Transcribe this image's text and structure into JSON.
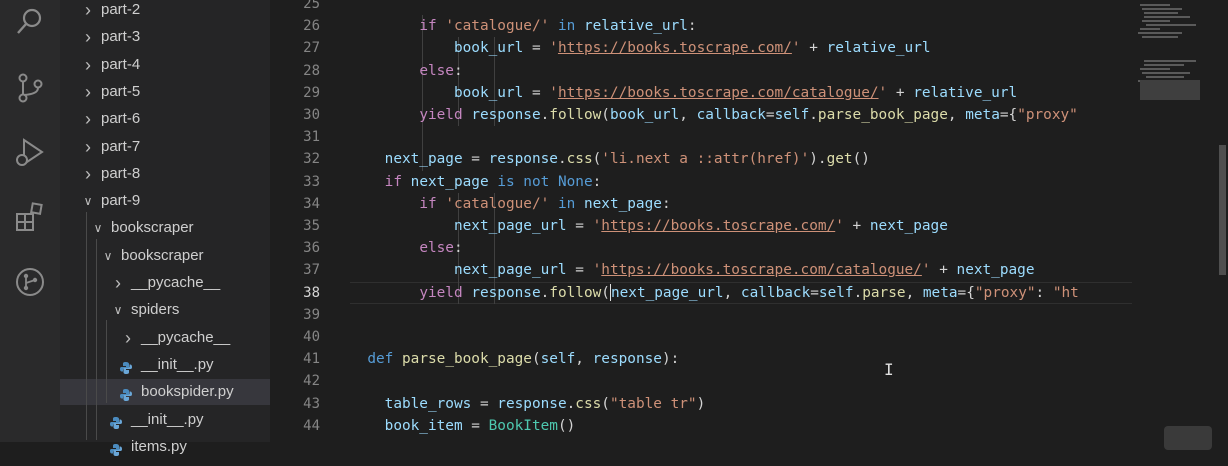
{
  "activity_bar": {
    "icons": [
      "search-icon",
      "source-control-icon",
      "run-debug-icon",
      "extensions-icon",
      "remote-explorer-icon"
    ]
  },
  "explorer": {
    "items": [
      {
        "label": "part-2",
        "kind": "folder",
        "expanded": false
      },
      {
        "label": "part-3",
        "kind": "folder",
        "expanded": false
      },
      {
        "label": "part-4",
        "kind": "folder",
        "expanded": false
      },
      {
        "label": "part-5",
        "kind": "folder",
        "expanded": false
      },
      {
        "label": "part-6",
        "kind": "folder",
        "expanded": false
      },
      {
        "label": "part-7",
        "kind": "folder",
        "expanded": false
      },
      {
        "label": "part-8",
        "kind": "folder",
        "expanded": false
      },
      {
        "label": "part-9",
        "kind": "folder",
        "expanded": true
      },
      {
        "label": "bookscraper",
        "kind": "folder",
        "expanded": true
      },
      {
        "label": "bookscraper",
        "kind": "folder",
        "expanded": true
      },
      {
        "label": "__pycache__",
        "kind": "folder",
        "expanded": false
      },
      {
        "label": "spiders",
        "kind": "folder",
        "expanded": true
      },
      {
        "label": "__pycache__",
        "kind": "folder",
        "expanded": false
      },
      {
        "label": "__init__.py",
        "kind": "python-file"
      },
      {
        "label": "bookspider.py",
        "kind": "python-file",
        "selected": true
      },
      {
        "label": "__init__.py",
        "kind": "python-file"
      },
      {
        "label": "items.py",
        "kind": "python-file"
      }
    ]
  },
  "editor": {
    "active_line": "38",
    "line_numbers": [
      "25",
      "26",
      "27",
      "28",
      "29",
      "30",
      "31",
      "32",
      "33",
      "34",
      "35",
      "36",
      "37",
      "38",
      "39",
      "40",
      "41",
      "42",
      "43",
      "44"
    ],
    "lines": [
      [],
      [
        [
          "p",
          "        "
        ],
        [
          "ctl",
          "if "
        ],
        [
          "str",
          "'catalogue/'"
        ],
        [
          "p",
          " "
        ],
        [
          "kw",
          "in"
        ],
        [
          "p",
          " "
        ],
        [
          "var",
          "relative_url"
        ],
        [
          "p",
          ":"
        ]
      ],
      [
        [
          "p",
          "            "
        ],
        [
          "var",
          "book_url"
        ],
        [
          "p",
          " = "
        ],
        [
          "str",
          "'"
        ],
        [
          "url",
          "https://books.toscrape.com/"
        ],
        [
          "str",
          "'"
        ],
        [
          "p",
          " + "
        ],
        [
          "var",
          "relative_url"
        ]
      ],
      [
        [
          "p",
          "        "
        ],
        [
          "ctl",
          "else"
        ],
        [
          "p",
          ":"
        ]
      ],
      [
        [
          "p",
          "            "
        ],
        [
          "var",
          "book_url"
        ],
        [
          "p",
          " = "
        ],
        [
          "str",
          "'"
        ],
        [
          "url",
          "https://books.toscrape.com/catalogue/"
        ],
        [
          "str",
          "'"
        ],
        [
          "p",
          " + "
        ],
        [
          "var",
          "relative_url"
        ]
      ],
      [
        [
          "p",
          "        "
        ],
        [
          "ctl",
          "yield"
        ],
        [
          "p",
          " "
        ],
        [
          "var",
          "response"
        ],
        [
          "p",
          "."
        ],
        [
          "fn",
          "follow"
        ],
        [
          "p",
          "("
        ],
        [
          "var",
          "book_url"
        ],
        [
          "p",
          ", "
        ],
        [
          "var",
          "callback"
        ],
        [
          "p",
          "="
        ],
        [
          "var",
          "self"
        ],
        [
          "p",
          "."
        ],
        [
          "fn",
          "parse_book_page"
        ],
        [
          "p",
          ", "
        ],
        [
          "var",
          "meta"
        ],
        [
          "p",
          "={"
        ],
        [
          "str",
          "\"proxy\""
        ]
      ],
      [],
      [
        [
          "p",
          "    "
        ],
        [
          "var",
          "next_page"
        ],
        [
          "p",
          " = "
        ],
        [
          "var",
          "response"
        ],
        [
          "p",
          "."
        ],
        [
          "fn",
          "css"
        ],
        [
          "p",
          "("
        ],
        [
          "str",
          "'li.next a ::attr(href)'"
        ],
        [
          "p",
          ")."
        ],
        [
          "fn",
          "get"
        ],
        [
          "p",
          "()"
        ]
      ],
      [
        [
          "p",
          "    "
        ],
        [
          "ctl",
          "if"
        ],
        [
          "p",
          " "
        ],
        [
          "var",
          "next_page"
        ],
        [
          "p",
          " "
        ],
        [
          "kw",
          "is not None"
        ],
        [
          "p",
          ":"
        ]
      ],
      [
        [
          "p",
          "        "
        ],
        [
          "ctl",
          "if "
        ],
        [
          "str",
          "'catalogue/'"
        ],
        [
          "p",
          " "
        ],
        [
          "kw",
          "in"
        ],
        [
          "p",
          " "
        ],
        [
          "var",
          "next_page"
        ],
        [
          "p",
          ":"
        ]
      ],
      [
        [
          "p",
          "            "
        ],
        [
          "var",
          "next_page_url"
        ],
        [
          "p",
          " = "
        ],
        [
          "str",
          "'"
        ],
        [
          "url",
          "https://books.toscrape.com/"
        ],
        [
          "str",
          "'"
        ],
        [
          "p",
          " + "
        ],
        [
          "var",
          "next_page"
        ]
      ],
      [
        [
          "p",
          "        "
        ],
        [
          "ctl",
          "else"
        ],
        [
          "p",
          ":"
        ]
      ],
      [
        [
          "p",
          "            "
        ],
        [
          "var",
          "next_page_url"
        ],
        [
          "p",
          " = "
        ],
        [
          "str",
          "'"
        ],
        [
          "url",
          "https://books.toscrape.com/catalogue/"
        ],
        [
          "str",
          "'"
        ],
        [
          "p",
          " + "
        ],
        [
          "var",
          "next_page"
        ]
      ],
      [
        [
          "p",
          "        "
        ],
        [
          "ctl",
          "yield"
        ],
        [
          "p",
          " "
        ],
        [
          "var",
          "response"
        ],
        [
          "p",
          "."
        ],
        [
          "fn",
          "follow"
        ],
        [
          "p",
          "("
        ],
        [
          "cursor",
          ""
        ],
        [
          "var",
          "next_page_url"
        ],
        [
          "p",
          ", "
        ],
        [
          "var",
          "callback"
        ],
        [
          "p",
          "="
        ],
        [
          "var",
          "self"
        ],
        [
          "p",
          "."
        ],
        [
          "fn",
          "parse"
        ],
        [
          "p",
          ", "
        ],
        [
          "var",
          "meta"
        ],
        [
          "p",
          "={"
        ],
        [
          "str",
          "\"proxy\""
        ],
        [
          "p",
          ": "
        ],
        [
          "str",
          "\"ht"
        ]
      ],
      [],
      [],
      [
        [
          "p",
          "  "
        ],
        [
          "kw",
          "def"
        ],
        [
          "p",
          " "
        ],
        [
          "fn",
          "parse_book_page"
        ],
        [
          "p",
          "("
        ],
        [
          "var",
          "self"
        ],
        [
          "p",
          ", "
        ],
        [
          "var",
          "response"
        ],
        [
          "p",
          "):"
        ]
      ],
      [],
      [
        [
          "p",
          "    "
        ],
        [
          "var",
          "table_rows"
        ],
        [
          "p",
          " = "
        ],
        [
          "var",
          "response"
        ],
        [
          "p",
          "."
        ],
        [
          "fn",
          "css"
        ],
        [
          "p",
          "("
        ],
        [
          "str",
          "\"table tr\""
        ],
        [
          "p",
          ")"
        ]
      ],
      [
        [
          "p",
          "    "
        ],
        [
          "var",
          "book_item"
        ],
        [
          "p",
          " = "
        ],
        [
          "cls",
          "BookItem"
        ],
        [
          "p",
          "()"
        ]
      ]
    ]
  },
  "colors": {
    "background": "#1e1e1e",
    "sidebar": "#252526",
    "activity_bar": "#2a2a2b",
    "keyword": "#569cd6",
    "control": "#c586c0",
    "string": "#ce9178",
    "function": "#dcdcaa",
    "class": "#4ec9b0",
    "variable": "#9cdcfe"
  }
}
